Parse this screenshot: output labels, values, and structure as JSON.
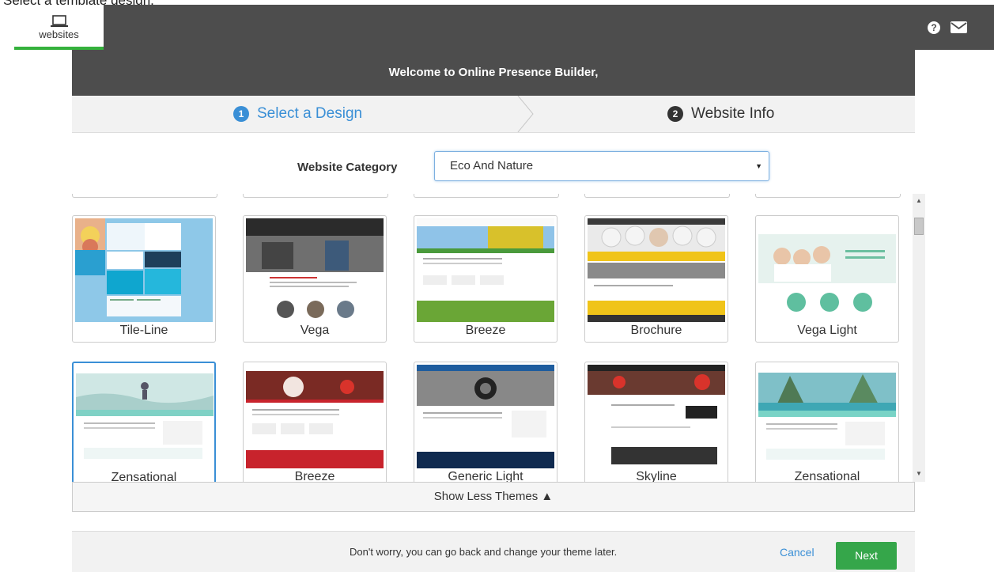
{
  "page": {
    "caption": "Select a template design."
  },
  "topbar": {
    "tab_label": "websites",
    "tab_icon": "laptop-icon",
    "help_icon": "question-circle-icon",
    "mail_icon": "envelope-icon"
  },
  "banner": {
    "welcome_text": "Welcome to Online Presence Builder,"
  },
  "steps": [
    {
      "number": "1",
      "label": "Select a Design",
      "active": true
    },
    {
      "number": "2",
      "label": "Website Info",
      "active": false
    }
  ],
  "category": {
    "label": "Website Category",
    "selected": "Eco And Nature"
  },
  "themes": [
    {
      "name": "Tile-Line",
      "selected": false
    },
    {
      "name": "Vega",
      "selected": false
    },
    {
      "name": "Breeze",
      "selected": false
    },
    {
      "name": "Brochure",
      "selected": false
    },
    {
      "name": "Vega Light",
      "selected": false
    },
    {
      "name": "Zensational",
      "selected": true
    },
    {
      "name": "Breeze",
      "selected": false
    },
    {
      "name": "Generic Light",
      "selected": false
    },
    {
      "name": "Skyline",
      "selected": false
    },
    {
      "name": "Zensational",
      "selected": false
    }
  ],
  "show_less_label": "Show Less Themes ▲",
  "footer": {
    "note": "Don't worry, you can go back and change your theme later.",
    "cancel_label": "Cancel",
    "next_label": "Next"
  },
  "colors": {
    "dark_bar": "#4d4d4d",
    "accent_blue": "#3a8fd6",
    "accent_green": "#35a64a",
    "panel_gray": "#f2f2f2"
  }
}
